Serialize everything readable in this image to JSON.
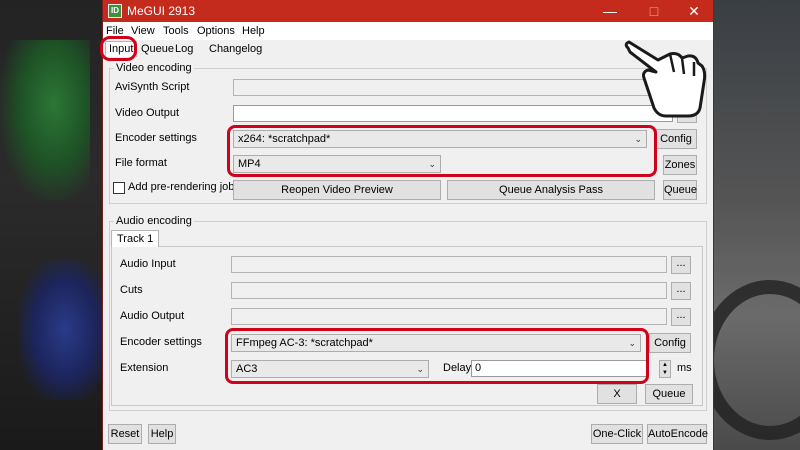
{
  "window": {
    "title": "MeGUI 2913",
    "icon_text": "ID",
    "controls": [
      "minimize-icon",
      "maximize-icon",
      "close-icon"
    ]
  },
  "menu": [
    "File",
    "View",
    "Tools",
    "Options",
    "Help"
  ],
  "tabs": [
    "Input",
    "Queue",
    "Log",
    "Changelog"
  ],
  "video": {
    "group_title": "Video encoding",
    "avisynth_label": "AviSynth Script",
    "avisynth_value": "",
    "output_label": "Video Output",
    "output_value": "",
    "browse_label": "...",
    "encoder_label": "Encoder settings",
    "encoder_value": "x264: *scratchpad*",
    "config_label": "Config",
    "format_label": "File format",
    "format_value": "MP4",
    "zones_label": "Zones",
    "prerender_label": "Add pre-rendering job",
    "reopen_label": "Reopen Video Preview",
    "queue_analysis_label": "Queue Analysis Pass",
    "queue_label": "Queue"
  },
  "audio": {
    "group_title": "Audio encoding",
    "track_tab": "Track 1",
    "input_label": "Audio Input",
    "input_value": "",
    "cuts_label": "Cuts",
    "cuts_value": "",
    "output_label": "Audio Output",
    "output_value": "",
    "browse_label": "...",
    "encoder_label": "Encoder settings",
    "encoder_value": "FFmpeg AC-3: *scratchpad*",
    "config_label": "Config",
    "extension_label": "Extension",
    "extension_value": "AC3",
    "delay_label": "Delay",
    "delay_value": "0",
    "delay_unit": "ms",
    "x_label": "X",
    "queue_label": "Queue"
  },
  "footer": {
    "reset_label": "Reset",
    "help_label": "Help",
    "oneclick_label": "One-Click",
    "autoencode_label": "AutoEncode"
  },
  "colors": {
    "titlebar": "#c42b1c",
    "highlight": "#d0021b"
  }
}
